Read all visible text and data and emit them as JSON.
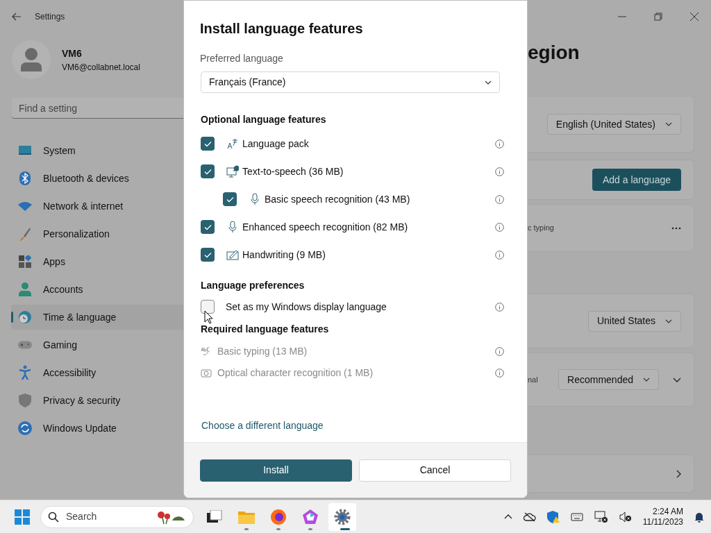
{
  "window": {
    "title": "Settings"
  },
  "user": {
    "name": "VM6",
    "email": "VM6@collabnet.local"
  },
  "search": {
    "placeholder": "Find a setting"
  },
  "nav": [
    {
      "label": "System",
      "selected": false
    },
    {
      "label": "Bluetooth & devices",
      "selected": false
    },
    {
      "label": "Network & internet",
      "selected": false
    },
    {
      "label": "Personalization",
      "selected": false
    },
    {
      "label": "Apps",
      "selected": false
    },
    {
      "label": "Accounts",
      "selected": false
    },
    {
      "label": "Time & language",
      "selected": true
    },
    {
      "label": "Gaming",
      "selected": false
    },
    {
      "label": "Accessibility",
      "selected": false
    },
    {
      "label": "Privacy & security",
      "selected": false
    },
    {
      "label": "Windows Update",
      "selected": false
    }
  ],
  "page": {
    "heading": "egion",
    "cards": [
      {
        "kind": "dropdown",
        "value": "English (United States)"
      },
      {
        "kind": "button",
        "value": "Add a language"
      },
      {
        "kind": "more",
        "text": "c typing"
      },
      {
        "kind": "dropdown",
        "value": "United States"
      },
      {
        "kind": "dropdown",
        "text": "nal",
        "value": "Recommended",
        "expander": true
      },
      {
        "kind": "link"
      }
    ]
  },
  "dialog": {
    "title": "Install language features",
    "preferred_label": "Preferred language",
    "preferred_value": "Français (France)",
    "optional_heading": "Optional language features",
    "optional": [
      {
        "label": "Language pack",
        "checked": true
      },
      {
        "label": "Text-to-speech (36 MB)",
        "checked": true,
        "children": [
          {
            "label": "Basic speech recognition (43 MB)",
            "checked": true
          }
        ]
      },
      {
        "label": "Enhanced speech recognition (82 MB)",
        "checked": true
      },
      {
        "label": "Handwriting (9 MB)",
        "checked": true
      }
    ],
    "preferences_heading": "Language preferences",
    "preferences": [
      {
        "label": "Set as my Windows display language",
        "checked": false
      }
    ],
    "required_heading": "Required language features",
    "required": [
      {
        "label": "Basic typing (13 MB)",
        "disabled": true
      },
      {
        "label": "Optical character recognition (1 MB)",
        "disabled": true
      }
    ],
    "link": "Choose a different language",
    "buttons": [
      {
        "label": "Install",
        "kind": "primary"
      },
      {
        "label": "Cancel",
        "kind": "secondary"
      }
    ]
  },
  "taskbar": {
    "search_placeholder": "Search",
    "time": "2:24 AM",
    "date": "11/11/2023"
  }
}
